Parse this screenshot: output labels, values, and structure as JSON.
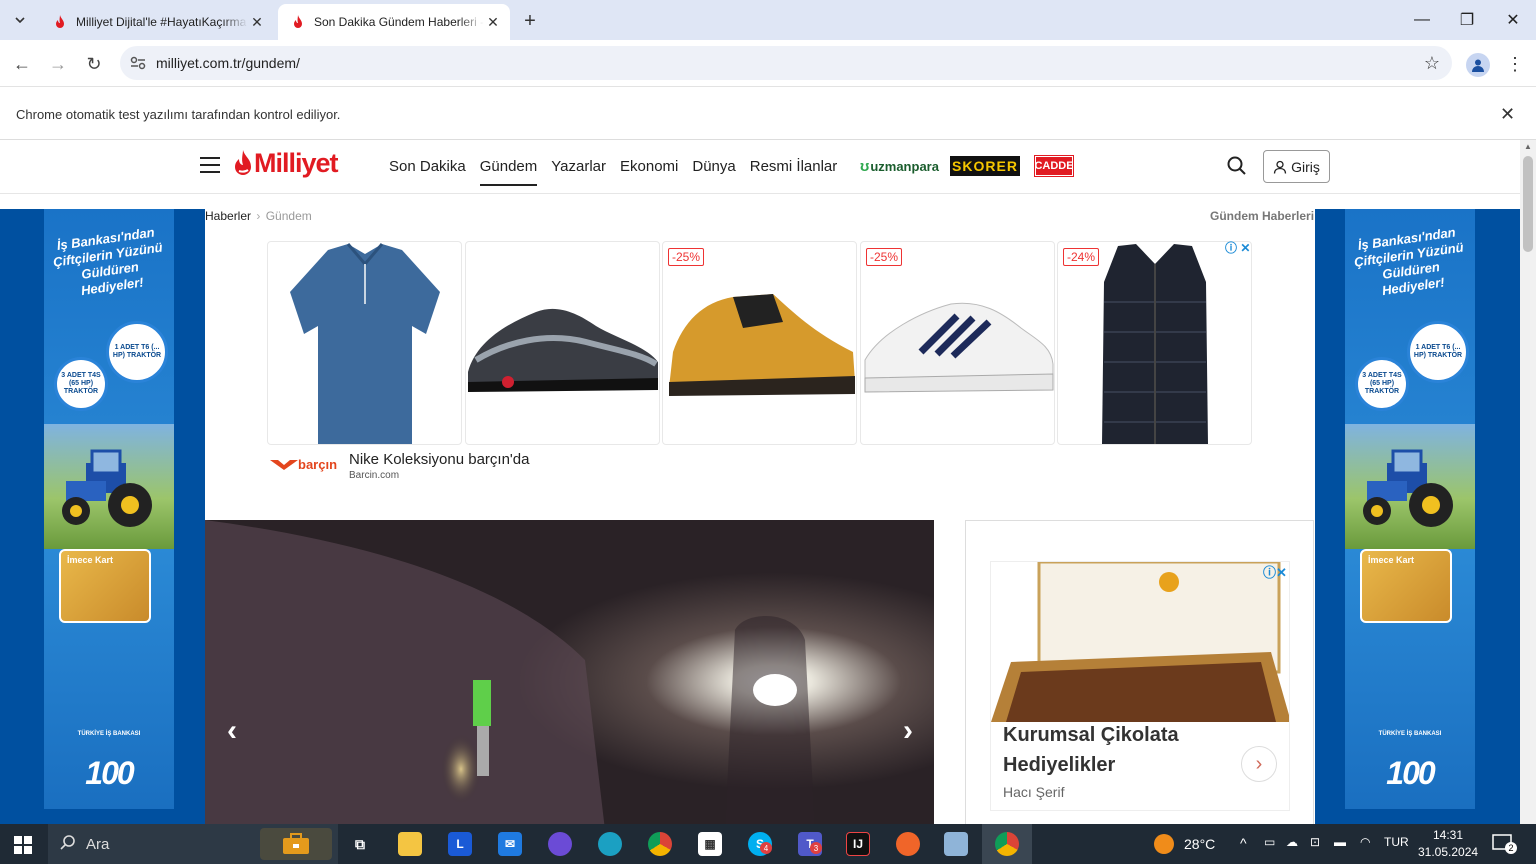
{
  "browser": {
    "tabs": [
      {
        "title": "Milliyet Dijital'le #HayatıKaçırma",
        "active": false
      },
      {
        "title": "Son Dakika Gündem Haberleri - ",
        "active": true
      }
    ],
    "url": "milliyet.com.tr/gundem/",
    "infobar": "Chrome otomatik test yazılımı tarafından kontrol ediliyor."
  },
  "site": {
    "logo": "Milliyet",
    "nav": [
      "Son Dakika",
      "Gündem",
      "Yazarlar",
      "Ekonomi",
      "Dünya",
      "Resmi İlanlar"
    ],
    "nav_active": "Gündem",
    "brands": {
      "uzmanpara": "uzmanpara",
      "skorer": "SKORER",
      "cadde": "CADDE"
    },
    "login": "Giriş",
    "breadcrumb": {
      "root": "Haberler",
      "current": "Gündem"
    },
    "section_label": "Gündem Haberleri"
  },
  "side_ad": {
    "headline": "İş Bankası'ndan Çiftçilerin Yüzünü Güldüren Hediyeler!",
    "badge1": "1 ADET T6 (... HP) TRAKTÖR",
    "badge2": "3 ADET T4S (65 HP) TRAKTÖR",
    "card": "İmece Kart",
    "bank": "TÜRKİYE İŞ BANKASI",
    "hundred": "100"
  },
  "product_ad": {
    "discounts": [
      "-25%",
      "-25%",
      "-24%"
    ],
    "brand": "barçın",
    "title": "Nike Koleksiyonu barçın'da",
    "domain": "Barcin.com"
  },
  "right_ad": {
    "title": "Kurumsal Çikolata Hediyelikler",
    "advertiser": "Hacı Şerif"
  },
  "taskbar": {
    "search": "Ara",
    "weather": "28°C",
    "lang": "TUR",
    "time": "14:31",
    "date": "31.05.2024",
    "notifications": "2",
    "badges": {
      "skype": "4",
      "teams": "3"
    }
  },
  "colors": {
    "brand_red": "#e11b22",
    "chrome_tabbar": "#dfe6f5",
    "taskbar": "#1f2a35",
    "side_ad_blue": "#1a73c7"
  }
}
